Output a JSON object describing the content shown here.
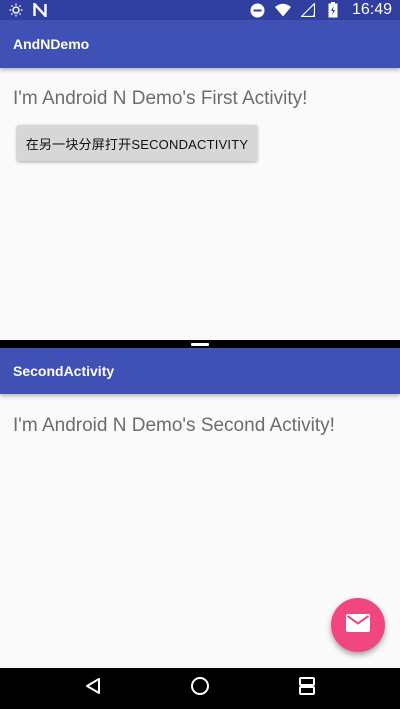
{
  "status_bar": {
    "time": "16:49",
    "icons": [
      "brightness-icon",
      "n-icon",
      "minus-circle-icon",
      "wifi-icon",
      "signal-icon",
      "battery-icon"
    ]
  },
  "top_pane": {
    "toolbar_title": "AndNDemo",
    "message": "I'm Android N Demo's First Activity!",
    "button_label": "在另一块分屏打开SECONDACTIVITY"
  },
  "bottom_pane": {
    "toolbar_title": "SecondActivity",
    "message": "I'm Android N Demo's Second Activity!"
  },
  "fab": {
    "icon": "mail-icon",
    "color": "#f0477f"
  },
  "nav_bar": {
    "icons": [
      "back-icon",
      "home-icon",
      "recents-split-icon"
    ]
  },
  "colors": {
    "primary": "#3f51b5",
    "primary_dark": "#303f9f",
    "background": "#fafafa",
    "button": "#d6d7d7",
    "accent": "#f0477f"
  }
}
